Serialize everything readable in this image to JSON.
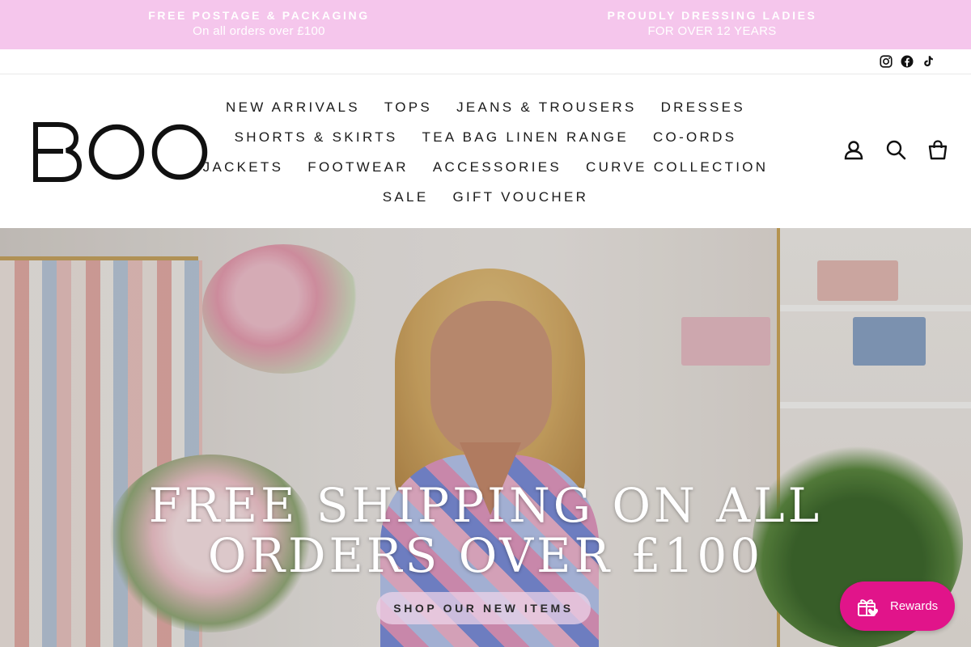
{
  "announcement": {
    "left_title": "FREE POSTAGE & PACKAGING",
    "left_subtitle": "On all orders over £100",
    "right_title": "PROUDLY DRESSING LADIES",
    "right_subtitle": "FOR OVER 12 YEARS",
    "background": "#f5c6ec"
  },
  "social": {
    "icons": [
      "instagram-icon",
      "facebook-icon",
      "tiktok-icon"
    ]
  },
  "header": {
    "logo_text": "BOO",
    "nav_rows": [
      [
        "NEW ARRIVALS",
        "TOPS",
        "JEANS & TROUSERS",
        "DRESSES"
      ],
      [
        "SHORTS & SKIRTS",
        "TEA BAG LINEN RANGE",
        "CO-ORDS"
      ],
      [
        "JACKETS",
        "FOOTWEAR",
        "ACCESSORIES",
        "CURVE COLLECTION"
      ],
      [
        "SALE",
        "GIFT VOUCHER"
      ]
    ],
    "nav": {
      "new_arrivals": "NEW ARRIVALS",
      "tops": "TOPS",
      "jeans_trousers": "JEANS & TROUSERS",
      "dresses": "DRESSES",
      "shorts_skirts": "SHORTS & SKIRTS",
      "tea_bag_linen": "TEA BAG LINEN RANGE",
      "co_ords": "CO-ORDS",
      "jackets": "JACKETS",
      "footwear": "FOOTWEAR",
      "accessories": "ACCESSORIES",
      "curve_collection": "CURVE COLLECTION",
      "sale": "SALE",
      "gift_voucher": "GIFT VOUCHER"
    },
    "icons": [
      "account-icon",
      "search-icon",
      "cart-icon"
    ]
  },
  "hero": {
    "title": "FREE SHIPPING ON ALL ORDERS OVER £100",
    "button_label": "SHOP OUR NEW ITEMS"
  },
  "rewards": {
    "label": "Rewards",
    "color": "#e1148a"
  }
}
